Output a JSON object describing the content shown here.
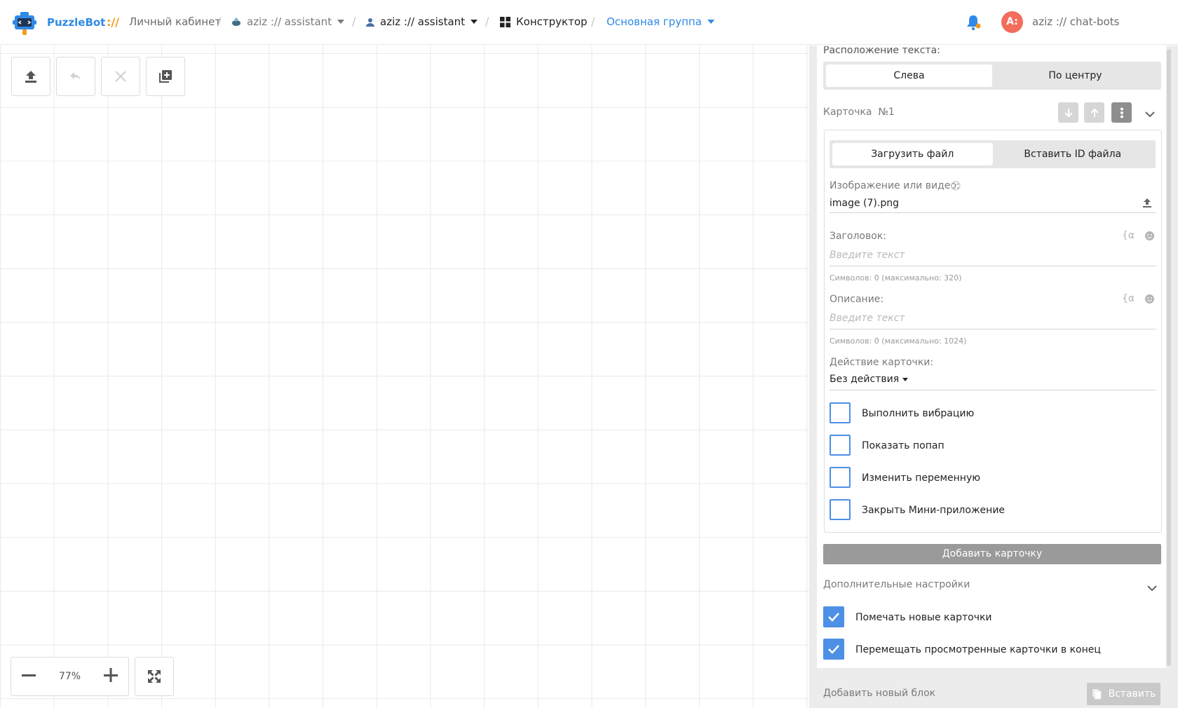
{
  "header": {
    "brand": "PuzzleBot",
    "brand_separator": "://",
    "home": "Личный кабинет",
    "bot_crumb_1": "aziz :// assistant",
    "bot_crumb_2": "aziz :// assistant",
    "constructor": "Конструктор",
    "group": "Основная группа",
    "avatar_initials": "A:",
    "account": "aziz :// chat-bots"
  },
  "canvas": {
    "zoom": "77%"
  },
  "panel": {
    "text_position_label": "Расположение текста:",
    "text_position_options": [
      "Слева",
      "По центру"
    ],
    "card_title": "Карточка  №1",
    "upload_options": [
      "Загрузить файл",
      "Вставить ID файла"
    ],
    "media_label": "Изображение или видео:",
    "media_value": "image (7).png",
    "title_label": "Заголовок:",
    "title_placeholder": "Введите текст",
    "title_hint": "Символов: 0 (максимально: 320)",
    "desc_label": "Описание:",
    "desc_placeholder": "Введите текст",
    "desc_hint": "Символов: 0 (максимально: 1024)",
    "var_glyph": "{α",
    "action_label": "Действие карточки:",
    "action_value": "Без действия",
    "checkboxes": [
      {
        "label": "Выполнить вибрацию",
        "checked": false
      },
      {
        "label": "Показать попап",
        "checked": false
      },
      {
        "label": "Изменить переменную",
        "checked": false
      },
      {
        "label": "Закрыть Мини-приложение",
        "checked": false
      }
    ],
    "add_card_button": "Добавить карточку",
    "extra_settings_label": "Дополнительные настройки",
    "extra_checkboxes": [
      {
        "label": "Помечать новые карточки",
        "checked": true
      },
      {
        "label": "Перемещать просмотренные карточки в конец",
        "checked": true
      }
    ],
    "add_block_label": "Добавить новый блок",
    "insert_button": "Вставить"
  },
  "colors": {
    "accent": "#2f8ae5",
    "checkbox": "#4d90e6",
    "avatar": "#f26d5b",
    "brand_sep": "#f39a1c"
  }
}
